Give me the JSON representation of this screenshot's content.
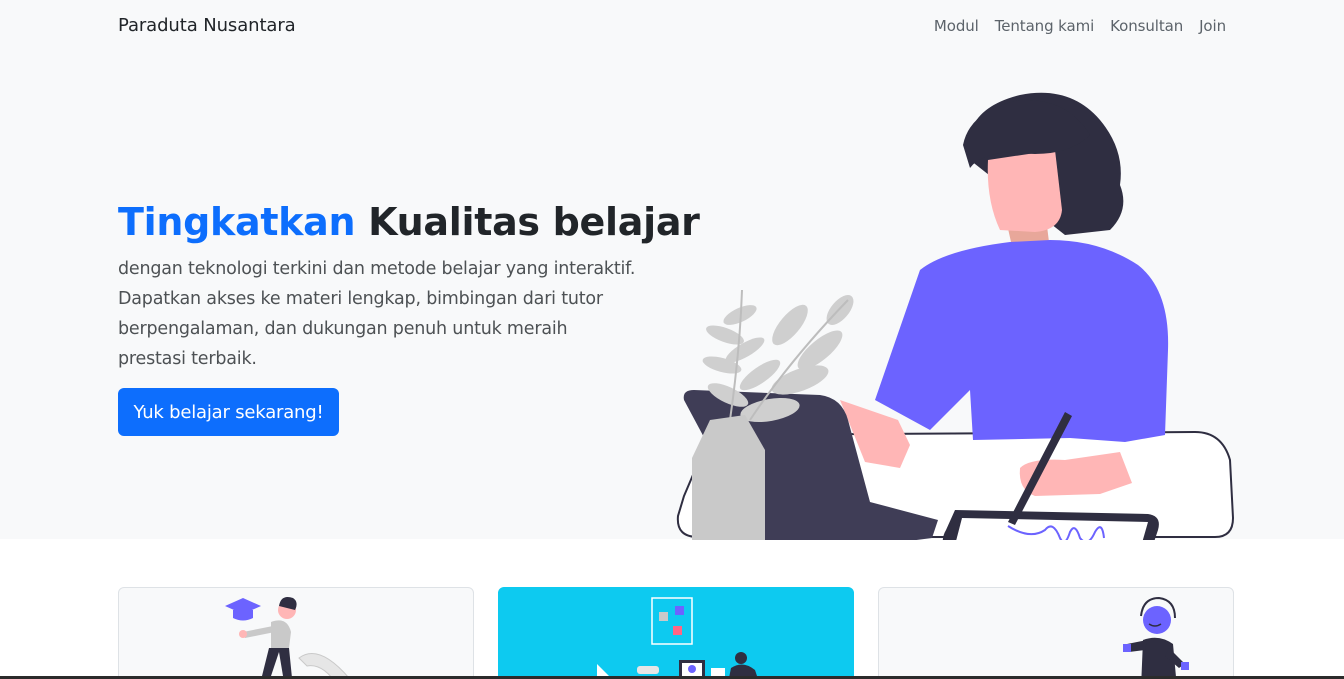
{
  "navbar": {
    "brand": "Paraduta Nusantara",
    "links": [
      "Modul",
      "Tentang kami",
      "Konsultan",
      "Join"
    ]
  },
  "hero": {
    "title_accent": "Tingkatkan",
    "title_rest": " Kualitas belajar",
    "description": "dengan teknologi terkini dan metode belajar yang interaktif. Dapatkan akses ke materi lengkap, bimbingan dari tutor berpengalaman, dan dukungan penuh untuk meraih prestasi terbaik.",
    "cta_label": "Yuk belajar sekarang!"
  },
  "colors": {
    "primary": "#0d6efd",
    "light_bg": "#f8f9fa",
    "info": "#0dcaf0",
    "illustration_purple": "#6c63ff",
    "illustration_dark": "#2f2e41"
  },
  "icons": [
    "woman-at-laptop-illustration",
    "graduate-illustration",
    "online-class-illustration",
    "headphones-person-illustration"
  ]
}
